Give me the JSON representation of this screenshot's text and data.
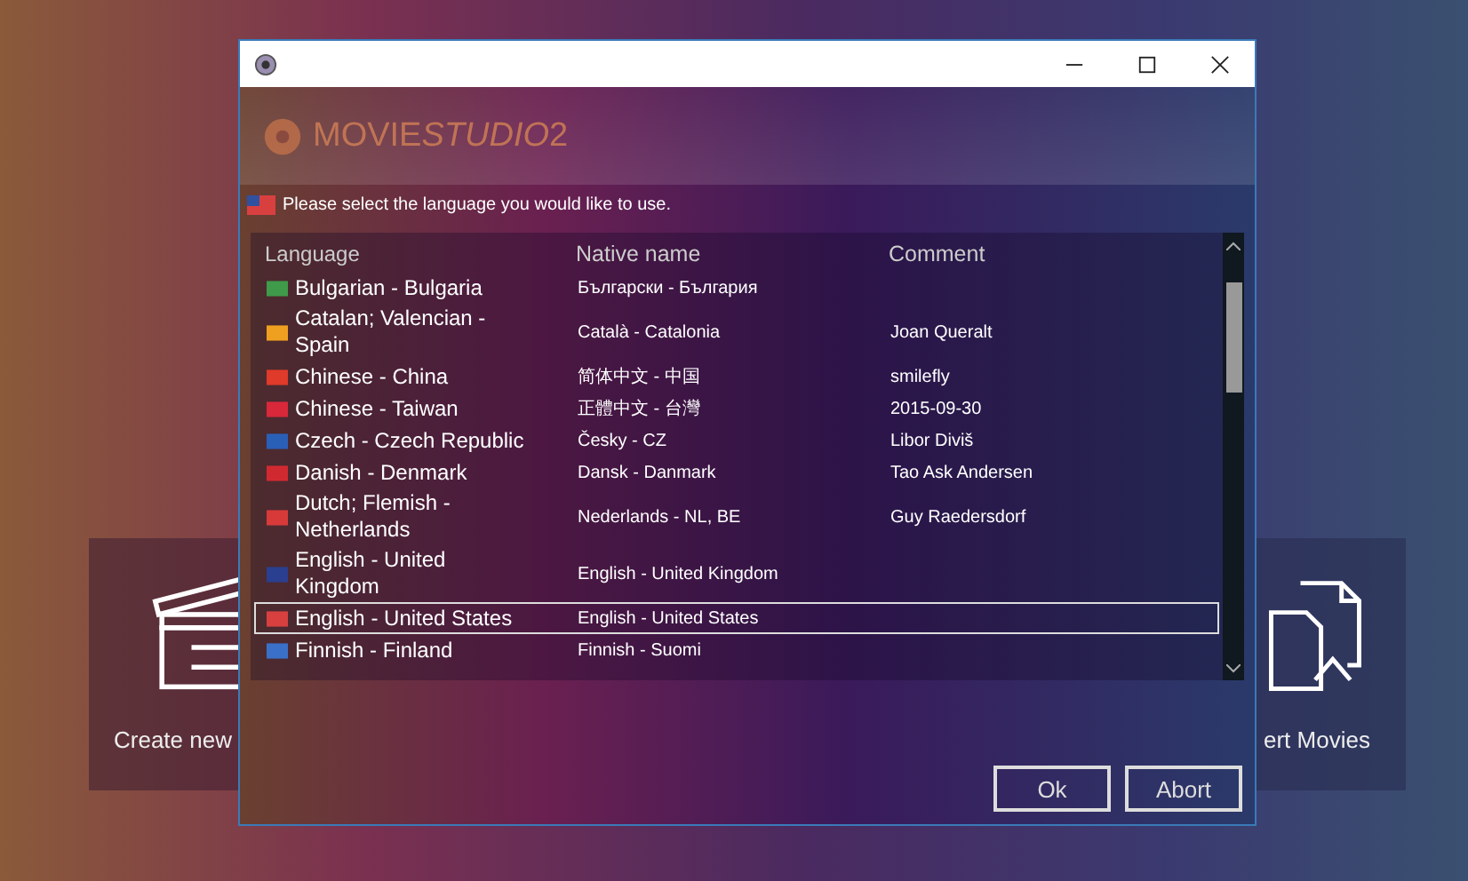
{
  "background_tiles": [
    {
      "kind": "clapper",
      "label": "Create new"
    },
    {
      "kind": "convert",
      "label": "ert Movies"
    }
  ],
  "dialog": {
    "logo": {
      "word1": "MOVIE",
      "word2": "STUDIO",
      "version": "2"
    },
    "instruction": "Please select the language you would like to use.",
    "table": {
      "columns": [
        "Language",
        "Native name",
        "Comment"
      ],
      "rows": [
        {
          "language": "Bulgarian - Bulgaria",
          "native": "Български - България",
          "comment": "",
          "color": "#3f9a4a",
          "selected": false
        },
        {
          "language": "Catalan; Valencian - Spain",
          "native": "Català - Catalonia",
          "comment": "Joan Queralt",
          "color": "#f0a020",
          "selected": false
        },
        {
          "language": "Chinese - China",
          "native": "简体中文 - 中国",
          "comment": "smilefly",
          "color": "#e03a2a",
          "selected": false
        },
        {
          "language": "Chinese - Taiwan",
          "native": "正體中文 - 台灣",
          "comment": "2015-09-30",
          "color": "#d8283a",
          "selected": false
        },
        {
          "language": "Czech - Czech Republic",
          "native": "Česky - CZ",
          "comment": "Libor Diviš",
          "color": "#2a5fb8",
          "selected": false
        },
        {
          "language": "Danish - Denmark",
          "native": "Dansk - Danmark",
          "comment": "Tao Ask Andersen",
          "color": "#d02a30",
          "selected": false
        },
        {
          "language": "Dutch; Flemish - Netherlands",
          "native": "Nederlands - NL, BE",
          "comment": "Guy Raedersdorf",
          "color": "#d83a3a",
          "selected": false
        },
        {
          "language": "English - United Kingdom",
          "native": "English - United Kingdom",
          "comment": "",
          "color": "#2a3f90",
          "selected": false
        },
        {
          "language": "English - United States",
          "native": "English - United States",
          "comment": "",
          "color": "#d84040",
          "selected": true
        },
        {
          "language": "Finnish - Finland",
          "native": "Finnish - Suomi",
          "comment": "",
          "color": "#3a70c8",
          "selected": false
        }
      ]
    },
    "buttons": [
      "Ok",
      "Abort"
    ]
  }
}
